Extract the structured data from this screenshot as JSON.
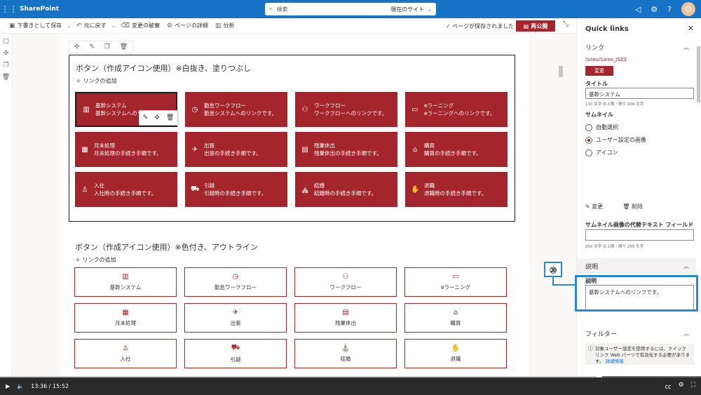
{
  "suite": {
    "brand": "SharePoint",
    "search_placeholder": "検索",
    "search_scope": "現在のサイト"
  },
  "command_bar": {
    "save_draft": "下書きとして保存",
    "undo": "元に戻す",
    "discard": "変更の破棄",
    "page_details": "ページの詳細",
    "analytics": "分析",
    "saved_status": "ページが保存されました",
    "republish": "再公開"
  },
  "section1": {
    "title": "ボタン（作成アイコン使用）※白抜き、塗りつぶし",
    "add_link": "リンクの追加",
    "buttons": [
      {
        "icon": "building-icon",
        "glyph": "▥",
        "title": "基幹システム",
        "desc": "基幹システムへのリ"
      },
      {
        "icon": "clock-icon",
        "glyph": "◷",
        "title": "勤怠ワークフロー",
        "desc": "勤怠システムへのリンクです。"
      },
      {
        "icon": "people-icon",
        "glyph": "⚇",
        "title": "ワークフロー",
        "desc": "ワークフローへのリンクです。"
      },
      {
        "icon": "monitor-icon",
        "glyph": "▭",
        "title": "eラーニング",
        "desc": "eラーニングへのリンクです。"
      },
      {
        "icon": "calendar-icon",
        "glyph": "▦",
        "title": "月末処理",
        "desc": "月末処理の手続き手順です。"
      },
      {
        "icon": "plane-icon",
        "glyph": "✈",
        "title": "出張",
        "desc": "出張の手続き手順です。"
      },
      {
        "icon": "overtime-icon",
        "glyph": "▤",
        "title": "残業休出",
        "desc": "残業休出の手続き手順です。"
      },
      {
        "icon": "store-icon",
        "glyph": "⌂",
        "title": "購買",
        "desc": "購買の手続き手順です。"
      },
      {
        "icon": "person-join-icon",
        "glyph": "♙",
        "title": "入社",
        "desc": "入社時の手続き手順です。"
      },
      {
        "icon": "truck-icon",
        "glyph": "⛟",
        "title": "引越",
        "desc": "引越時の手続き手順です。"
      },
      {
        "icon": "wedding-icon",
        "glyph": "⛪",
        "title": "結婚",
        "desc": "結婚時の手続き手順です。"
      },
      {
        "icon": "handshake-icon",
        "glyph": "✋",
        "title": "退職",
        "desc": "退職時の手続き手順です。"
      }
    ]
  },
  "section2": {
    "title": "ボタン（作成アイコン使用）※色付き、アウトライン",
    "add_link": "リンクの追加",
    "buttons": [
      {
        "icon": "building-icon",
        "glyph": "▥",
        "title": "基幹システム"
      },
      {
        "icon": "clock-icon",
        "glyph": "◷",
        "title": "勤怠ワークフロー"
      },
      {
        "icon": "people-icon",
        "glyph": "⚇",
        "title": "ワークフロー"
      },
      {
        "icon": "monitor-icon",
        "glyph": "▭",
        "title": "eラーニング"
      },
      {
        "icon": "calendar-icon",
        "glyph": "▦",
        "title": "月末処理"
      },
      {
        "icon": "plane-icon",
        "glyph": "✈",
        "title": "出張"
      },
      {
        "icon": "overtime-icon",
        "glyph": "▤",
        "title": "残業休出"
      },
      {
        "icon": "store-icon",
        "glyph": "⌂",
        "title": "購買"
      },
      {
        "icon": "person-join-icon",
        "glyph": "♙",
        "title": "入社"
      },
      {
        "icon": "truck-icon",
        "glyph": "⛟",
        "title": "引越"
      },
      {
        "icon": "wedding-icon",
        "glyph": "⛪",
        "title": "結婚"
      },
      {
        "icon": "handshake-icon",
        "glyph": "✋",
        "title": "退職"
      }
    ]
  },
  "pane": {
    "title": "Quick links",
    "link_group": "リンク",
    "link_url": "/sites/Sales_JSZ3",
    "change_button": "変更",
    "title_label": "タイトル",
    "title_value": "基幹システム",
    "title_counter": "110 文字 の上限・残り 104 文字",
    "thumbnail_label": "サムネイル",
    "radio_auto": "自動選択",
    "radio_custom": "ユーザー設定の画像",
    "radio_icon": "アイコン",
    "edit_action": "変更",
    "remove_action": "削除",
    "alt_text_label": "サムネイル画像の代替テキスト フィールド",
    "alt_counter": "255 文字 の上限・残り 255 文字",
    "desc_group": "説明",
    "desc_label": "説明",
    "desc_value": "基幹システムへのリンクです。",
    "filter_group": "フィルター",
    "filter_info": "対象ユーザー設定を使用するには、クイック リンク Web パーツで有効化する必要があります。",
    "filter_link": "詳細情報"
  },
  "annotation": {
    "number": "⑳",
    "color": "#2b88d8"
  },
  "player": {
    "current_time": "13:36",
    "separator": "/",
    "total_time": "15:52",
    "progress_percent": 85.5
  },
  "colors": {
    "suite_blue": "#1773c5",
    "accent_red": "#a4262c"
  }
}
